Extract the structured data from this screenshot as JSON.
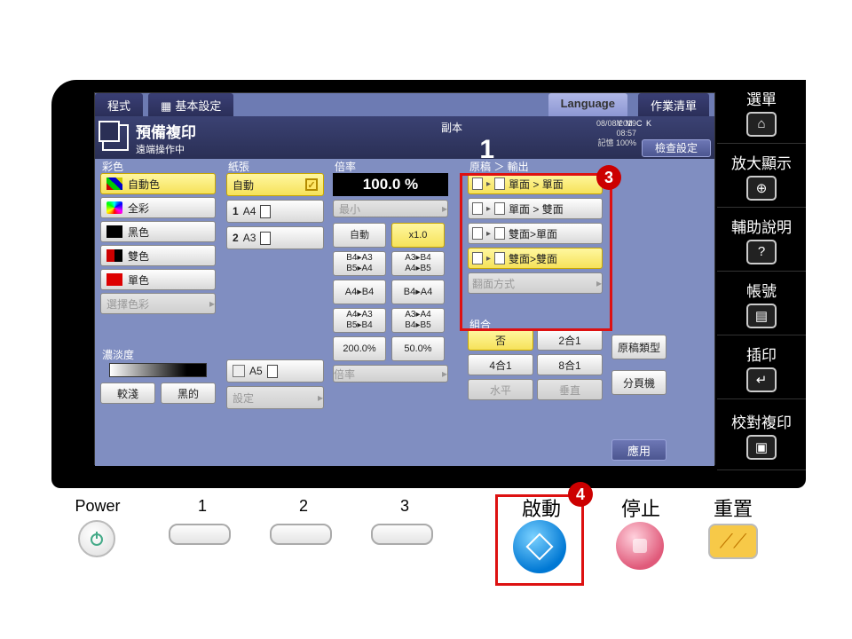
{
  "topbar": {
    "program_tab": "程式",
    "basic_tab": "基本設定",
    "language_tab": "Language",
    "jobs_tab": "作業清單"
  },
  "status": {
    "title": "預備複印",
    "sub": "遠端操作中",
    "copies_label": "副本",
    "copies_value": "1",
    "date": "08/08/2019",
    "time": "08:57",
    "mem_label": "記憶",
    "mem_value": "100%",
    "ymck": "Y M C K",
    "check_settings": "檢查設定"
  },
  "color": {
    "label": "彩色",
    "auto": "自動色",
    "full": "全彩",
    "black": "黑色",
    "two": "雙色",
    "single": "單色",
    "select": "選擇色彩"
  },
  "density": {
    "label": "濃淡度",
    "lighter": "較淺",
    "darker": "黑的"
  },
  "paper": {
    "label": "紙張",
    "auto": "自動",
    "tray1": "A4",
    "tray1_num": "1",
    "tray2": "A3",
    "tray2_num": "2",
    "tray5": "A5",
    "settings": "設定"
  },
  "zoom": {
    "label": "倍率",
    "value": "100.0 %",
    "min": "最小",
    "auto": "自動",
    "x1": "x1.0",
    "b4a3": "B4▸A3",
    "b5a4": "B5▸A4",
    "a3b4": "A3▸B4",
    "a4b5": "A4▸B5",
    "a4b4": "A4▸B4",
    "b4a4": "B4▸A4",
    "a4a3": "A4▸A3",
    "b5b4": "B5▸B4",
    "a3a4": "A3▸A4",
    "b4b5": "B4▸B5",
    "p200": "200.0%",
    "p50": "50.0%",
    "footer": "倍率"
  },
  "oo": {
    "label": "原稿 ＞ 輸出",
    "s1": "單面 > 單面",
    "s2": "單面 > 雙面",
    "s3": "雙面>單面",
    "s4": "雙面>雙面",
    "flip": "翻面方式"
  },
  "comb": {
    "label": "組合",
    "none": "否",
    "c2": "2合1",
    "c4": "4合1",
    "c8": "8合1",
    "hori": "水平",
    "vert": "垂直"
  },
  "side": {
    "orig_type": "原稿類型",
    "separator": "分頁機",
    "apply": "應用"
  },
  "strip": {
    "menu": "選單",
    "enlarge": "放大顯示",
    "help": "輔助說明",
    "account": "帳號",
    "interrupt": "插印",
    "proof": "校對複印"
  },
  "phys": {
    "power": "Power",
    "n1": "1",
    "n2": "2",
    "n3": "3",
    "start": "啟動",
    "stop": "停止",
    "reset": "重置"
  },
  "callout": {
    "n3": "3",
    "n4": "4"
  }
}
